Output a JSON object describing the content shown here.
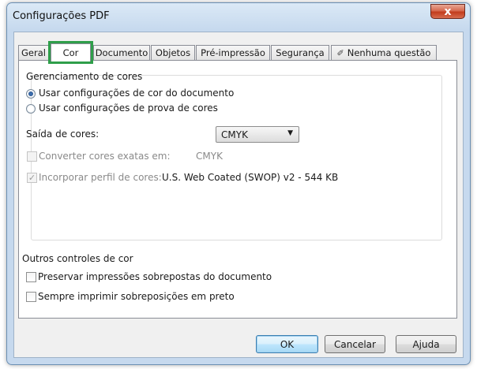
{
  "window": {
    "title": "Configurações PDF",
    "close_glyph": "x"
  },
  "tabs": [
    {
      "label": "Geral"
    },
    {
      "label": "Cor",
      "active": true
    },
    {
      "label": "Documento"
    },
    {
      "label": "Objetos"
    },
    {
      "label": "Pré-impressão"
    },
    {
      "label": "Segurança"
    },
    {
      "label": "Nenhuma questão",
      "icon": "pen-check-icon"
    }
  ],
  "color_management": {
    "title": "Gerenciamento de cores",
    "radio_document": "Usar configurações de cor do documento",
    "radio_proof": "Usar configurações de prova de cores",
    "output_label": "Saída de cores:",
    "output_value": "CMYK",
    "convert_label": "Converter cores exatas em:",
    "convert_value": "CMYK",
    "embed_label": "Incorporar perfil de cores:",
    "embed_value": "U.S. Web Coated (SWOP) v2 - 544 KB"
  },
  "other_controls": {
    "title": "Outros controles de cor",
    "preserve_label": "Preservar impressões sobrepostas do documento",
    "overprint_black_label": "Sempre imprimir sobreposições em preto"
  },
  "buttons": {
    "ok": "OK",
    "cancel": "Cancelar",
    "help": "Ajuda"
  },
  "colors": {
    "highlight": "#2f9e4a",
    "close_button": "#c23c1d"
  }
}
